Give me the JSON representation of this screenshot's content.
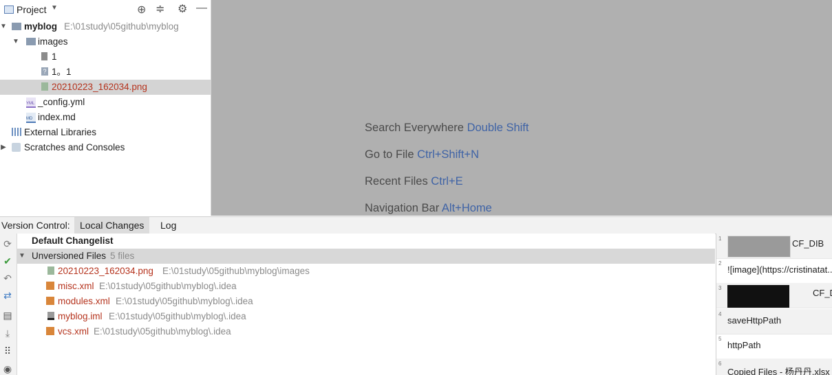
{
  "project_panel": {
    "title": "Project",
    "tree": [
      {
        "label": "myblog",
        "path": "E:\\01study\\05github\\myblog",
        "icon": "folder-icon"
      },
      {
        "label": "images",
        "icon": "folder-icon"
      },
      {
        "label": "1",
        "icon": "text-file-icon"
      },
      {
        "label": "1。1",
        "icon": "unknown-file-icon"
      },
      {
        "label": "20210223_162034.png",
        "icon": "image-file-icon"
      },
      {
        "label": "_config.yml",
        "icon": "yml-file-icon"
      },
      {
        "label": "index.md",
        "icon": "md-file-icon"
      },
      {
        "label": "External Libraries",
        "icon": "libraries-icon"
      },
      {
        "label": "Scratches and Consoles",
        "icon": "scratches-icon"
      }
    ]
  },
  "editor_hints": [
    {
      "text": "Search Everywhere",
      "key": "Double Shift"
    },
    {
      "text": "Go to File",
      "key": "Ctrl+Shift+N"
    },
    {
      "text": "Recent Files",
      "key": "Ctrl+E"
    },
    {
      "text": "Navigation Bar",
      "key": "Alt+Home"
    }
  ],
  "version_control": {
    "label": "Version Control:",
    "tabs": [
      "Local Changes",
      "Log"
    ],
    "default_changelist": "Default Changelist",
    "unversioned": {
      "label": "Unversioned Files",
      "count": "5 files"
    },
    "files": [
      {
        "name": "20210223_162034.png",
        "path": "E:\\01study\\05github\\myblog\\images"
      },
      {
        "name": "misc.xml",
        "path": "E:\\01study\\05github\\myblog\\.idea"
      },
      {
        "name": "modules.xml",
        "path": "E:\\01study\\05github\\myblog\\.idea"
      },
      {
        "name": "myblog.iml",
        "path": "E:\\01study\\05github\\myblog\\.idea"
      },
      {
        "name": "vcs.xml",
        "path": "E:\\01study\\05github\\myblog\\.idea"
      }
    ]
  },
  "clipboard": {
    "items": [
      {
        "index": "1",
        "text": "CF_DIB"
      },
      {
        "index": "2",
        "text": "![image](https://cristinatat..."
      },
      {
        "index": "3",
        "text": "CF_DIB"
      },
      {
        "index": "4",
        "text": "saveHttpPath"
      },
      {
        "index": "5",
        "text": "httpPath"
      },
      {
        "index": "6",
        "text": "Copied Files - 杨丹丹.xlsx"
      }
    ]
  },
  "colors": {
    "accent": "#3f63a6",
    "unversioned": "#b5331d",
    "selection": "#d4d4d4"
  }
}
